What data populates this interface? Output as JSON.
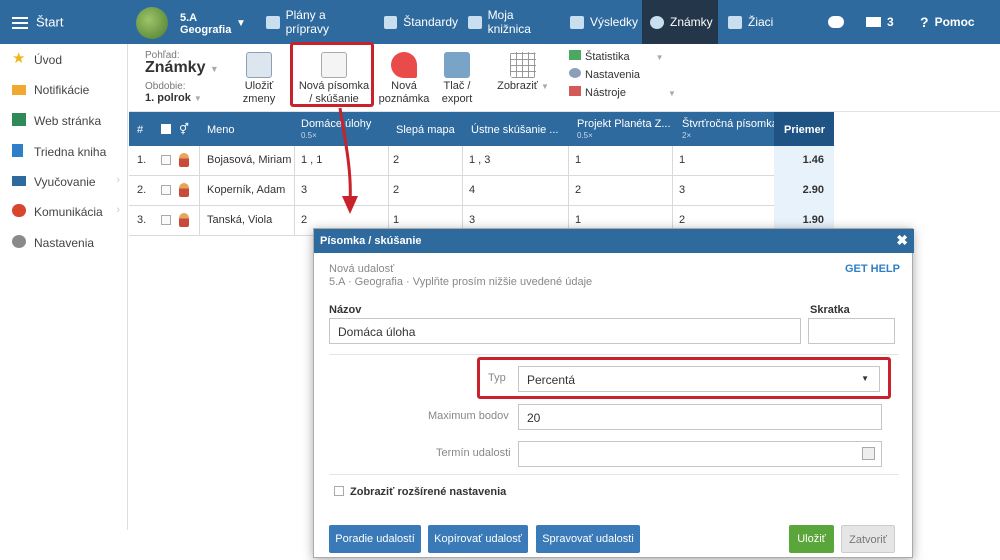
{
  "topbar": {
    "start": "Štart",
    "class_name": "5.A",
    "subject": "Geografia",
    "nav": [
      "Plány a prípravy",
      "Štandardy",
      "Moja knižnica",
      "Výsledky",
      "Známky",
      "Žiaci"
    ],
    "messages_count": "3",
    "help": "Pomoc"
  },
  "sidebar": {
    "items": [
      "Úvod",
      "Notifikácie",
      "Web stránka",
      "Triedna kniha",
      "Vyučovanie",
      "Komunikácia",
      "Nastavenia"
    ]
  },
  "toolbar": {
    "view_label": "Pohľad:",
    "view_value": "Známky",
    "period_label": "Obdobie:",
    "period_value": "1. polrok",
    "save": "Uložiť\nzmeny",
    "new_test": "Nová písomka\n/ skúšanie",
    "new_note": "Nová\npoznámka",
    "print": "Tlač /\nexport",
    "show": "Zobraziť",
    "statistics": "Štatistika",
    "settings": "Nastavenia",
    "tools": "Nástroje"
  },
  "grid": {
    "headers": {
      "num": "#",
      "name": "Meno",
      "avg": "Priemer"
    },
    "columns": [
      {
        "title": "Domáce úlohy",
        "mult": "0.5×"
      },
      {
        "title": "Slepá mapa",
        "mult": ""
      },
      {
        "title": "Ústne skúšanie ...",
        "mult": ""
      },
      {
        "title": "Projekt Planéta Z...",
        "mult": "0.5×"
      },
      {
        "title": "Štvrťročná písomka",
        "mult": "2×"
      }
    ],
    "rows": [
      {
        "n": "1.",
        "name": "Bojasová, Miriam",
        "c": [
          "1 , 1",
          "2",
          "1 , 3",
          "1",
          "1"
        ],
        "avg": "1.46"
      },
      {
        "n": "2.",
        "name": "Koperník, Adam",
        "c": [
          "3",
          "2",
          "4",
          "2",
          "3"
        ],
        "avg": "2.90"
      },
      {
        "n": "3.",
        "name": "Tanská, Viola",
        "c": [
          "2",
          "1",
          "3",
          "1",
          "2"
        ],
        "avg": "1.90"
      }
    ]
  },
  "modal": {
    "title": "Písomka / skúšanie",
    "subtitle": "Nová udalosť",
    "context": "5.A · Geografia · Vyplňte prosím nižšie uvedené údaje",
    "get_help": "GET HELP",
    "name_label": "Názov",
    "name_value": "Domáca úloha",
    "short_label": "Skratka",
    "short_value": "",
    "type_label": "Typ",
    "type_value": "Percentá",
    "max_label": "Maximum bodov",
    "max_value": "20",
    "date_label": "Termín udalosti",
    "date_value": "",
    "advanced": "Zobraziť rozšírené nastavenia",
    "btn_order": "Poradie udalostí",
    "btn_copy": "Kopírovať udalosť",
    "btn_manage": "Spravovať udalosti",
    "btn_save": "Uložiť",
    "btn_close": "Zatvoriť"
  },
  "colors": {
    "primary": "#2e6a9e",
    "highlight": "#c8222c",
    "save": "#5aa63a"
  }
}
